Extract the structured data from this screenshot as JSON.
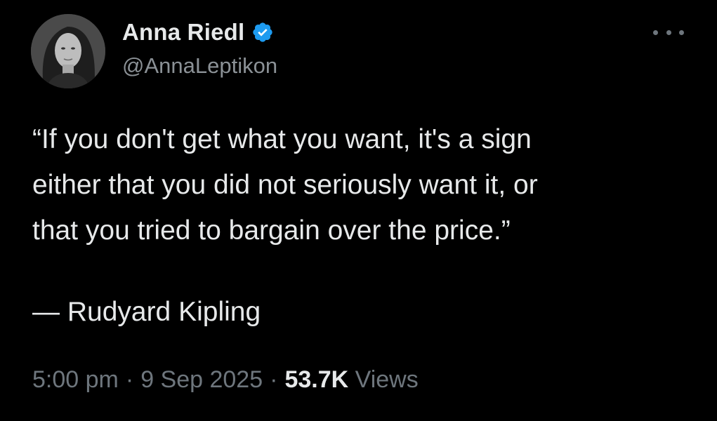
{
  "author": {
    "display_name": "Anna Riedl",
    "handle": "@AnnaLeptikon",
    "verified": true,
    "verified_color": "#1d9bf0",
    "avatar": "avatar-photo"
  },
  "tweet": {
    "quote_lines": [
      "“If you don't get what you want, it's a sign",
      "either that you did not seriously want it, or",
      "that you tried to bargain over the price.”"
    ],
    "attribution": "— Rudyard Kipling"
  },
  "meta": {
    "time": "5:00 pm",
    "separator": "·",
    "date": "9 Sep 2025",
    "views_count": "53.7K",
    "views_label": "Views"
  },
  "icons": {
    "more": "more-options-icon",
    "verified": "verified-badge-icon"
  },
  "colors": {
    "background": "#000000",
    "primary_text": "#e7e9ea",
    "secondary_text": "#6e767d"
  }
}
